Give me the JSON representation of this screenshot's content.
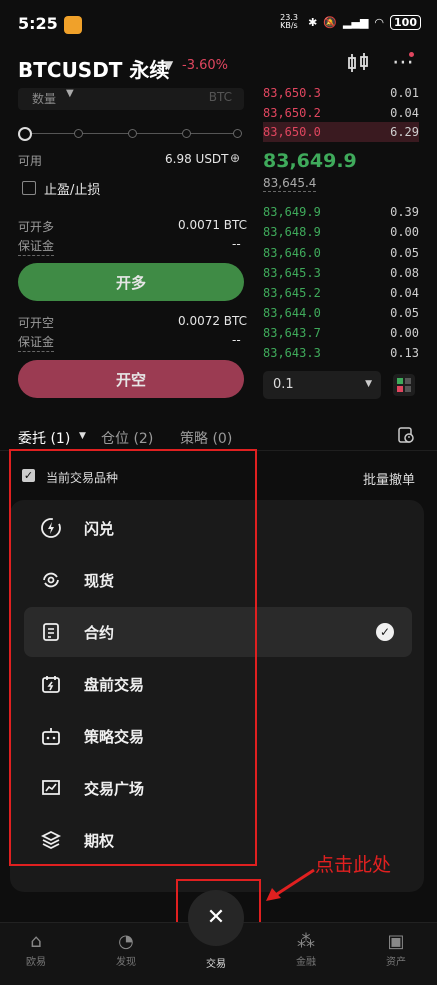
{
  "status": {
    "time": "5:25",
    "speed": "23.3 KB/s",
    "battery": "100"
  },
  "header": {
    "pair": "BTCUSDT 永续",
    "change": "-3.60%"
  },
  "form": {
    "qty_label": "数量",
    "qty_unit": "BTC",
    "available_label": "可用",
    "available_value": "6.98 USDT",
    "tpsl_label": "止盈/止损",
    "open_long_label": "可开多",
    "open_long_value": "0.0071 BTC",
    "margin_label": "保证金",
    "margin_long": "--",
    "open_long_button": "开多",
    "open_short_label": "可开空",
    "open_short_value": "0.0072 BTC",
    "margin_short": "--",
    "open_short_button": "开空"
  },
  "orderbook": {
    "asks": [
      {
        "p": "83,650.3",
        "q": "0.01"
      },
      {
        "p": "83,650.2",
        "q": "0.04"
      },
      {
        "p": "83,650.0",
        "q": "6.29"
      }
    ],
    "last_price": "83,649.9",
    "mark_price": "83,645.4",
    "bids": [
      {
        "p": "83,649.9",
        "q": "0.39"
      },
      {
        "p": "83,648.9",
        "q": "0.00"
      },
      {
        "p": "83,646.0",
        "q": "0.05"
      },
      {
        "p": "83,645.3",
        "q": "0.08"
      },
      {
        "p": "83,645.2",
        "q": "0.04"
      },
      {
        "p": "83,644.0",
        "q": "0.05"
      },
      {
        "p": "83,643.7",
        "q": "0.00"
      },
      {
        "p": "83,643.3",
        "q": "0.13"
      }
    ],
    "depth": "0.1"
  },
  "tabs": {
    "orders": "委托 (1)",
    "positions": "仓位 (2)",
    "strategy": "策略 (0)"
  },
  "filter": {
    "current_symbol": "当前交易品种",
    "batch_cancel": "批量撤单"
  },
  "menu": [
    {
      "label": "闪兑",
      "icon": "flash-icon"
    },
    {
      "label": "现货",
      "icon": "spot-icon"
    },
    {
      "label": "合约",
      "icon": "contract-icon",
      "selected": true
    },
    {
      "label": "盘前交易",
      "icon": "premarket-icon"
    },
    {
      "label": "策略交易",
      "icon": "bot-icon"
    },
    {
      "label": "交易广场",
      "icon": "plaza-icon"
    },
    {
      "label": "期权",
      "icon": "options-icon"
    }
  ],
  "annotation": "点击此处",
  "nav": [
    {
      "label": "欧易",
      "icon": "home-icon"
    },
    {
      "label": "发现",
      "icon": "discover-icon"
    },
    {
      "label": "交易",
      "icon": "close-icon"
    },
    {
      "label": "金融",
      "icon": "finance-icon"
    },
    {
      "label": "资产",
      "icon": "wallet-icon"
    }
  ],
  "colors": {
    "green": "#3f8b45",
    "red": "#9b3b52",
    "ask": "#e0465f",
    "bid": "#3faa5b",
    "annotation": "#e02020"
  }
}
